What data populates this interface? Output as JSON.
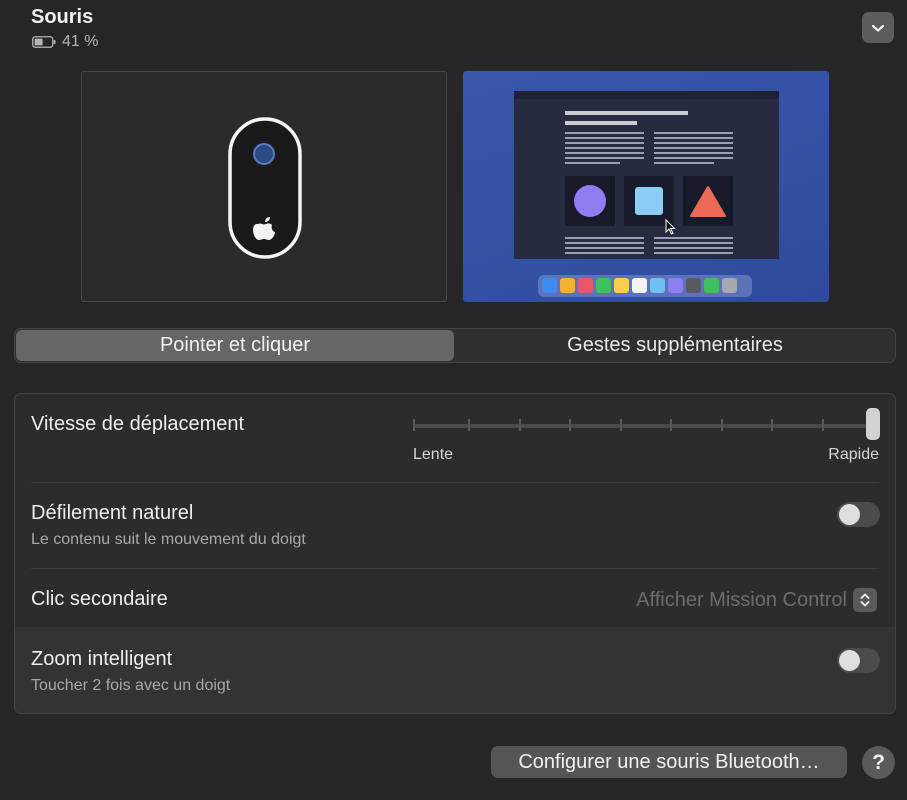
{
  "device": {
    "name": "Souris",
    "battery": "41 %"
  },
  "tabs": [
    {
      "label": "Pointer et cliquer",
      "active": true
    },
    {
      "label": "Gestes supplémentaires",
      "active": false
    }
  ],
  "settings": {
    "tracking_speed": {
      "label": "Vitesse de déplacement",
      "min_label": "Lente",
      "max_label": "Rapide",
      "value_fraction": 1.0
    },
    "natural_scrolling": {
      "label": "Défilement naturel",
      "description": "Le contenu suit le mouvement du doigt",
      "enabled": false
    },
    "secondary_click": {
      "label": "Clic secondaire",
      "value": "Afficher Mission Control"
    },
    "smart_zoom": {
      "label": "Zoom intelligent",
      "description": "Toucher 2 fois avec un doigt",
      "enabled": false
    }
  },
  "footer": {
    "bluetooth_button": "Configurer une souris Bluetooth…",
    "help_button": "?"
  },
  "icons": {
    "battery": "battery-icon",
    "collapse": "chevron-down-icon",
    "apple": "apple-logo-icon",
    "stepper": "up-down-chevron-icon"
  },
  "colors": {
    "background": "#262628",
    "desktop_preview": "#3a56ad",
    "active_tab": "#666668"
  }
}
